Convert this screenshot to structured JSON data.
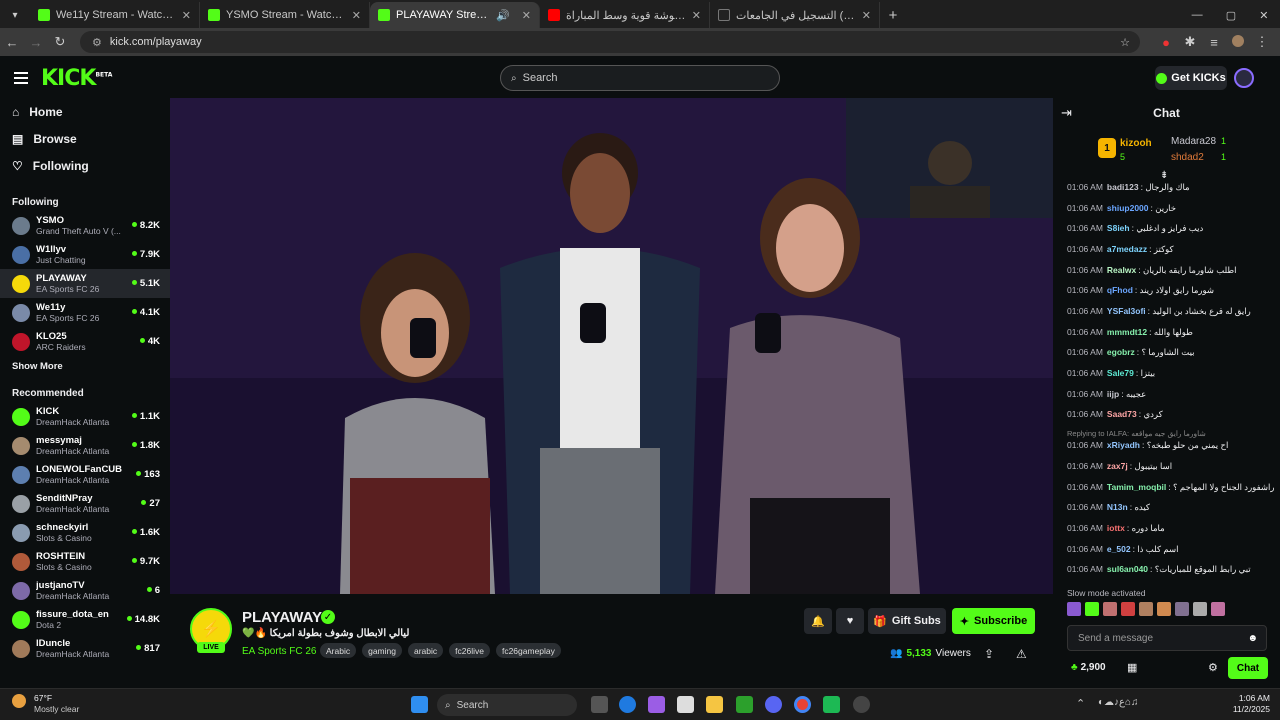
{
  "browser": {
    "tabs": [
      {
        "title": "We11y Stream - Watch Live on"
      },
      {
        "title": "YSMO Stream - Watch Live on"
      },
      {
        "title": "PLAYAWAY Stream - Watch"
      },
      {
        "title": "هوشة قوية وسط المباراة🔥😂"
      },
      {
        "title": "التسجيل في الجامعات (sajjel@)"
      }
    ],
    "url": "kick.com/playaway"
  },
  "header": {
    "logo": "KICK",
    "logo_badge": "BETA",
    "search_placeholder": "Search",
    "get_kicks_label": "Get KICKs"
  },
  "sidebar": {
    "nav": [
      {
        "label": "Home",
        "icon": "home-icon"
      },
      {
        "label": "Browse",
        "icon": "browse-icon"
      },
      {
        "label": "Following",
        "icon": "heart-icon"
      }
    ],
    "following_header": "Following",
    "following": [
      {
        "name": "YSMO",
        "category": "Grand Theft Auto V (...",
        "viewers": "8.2K",
        "color": "#6b7b8c"
      },
      {
        "name": "W1llyv",
        "category": "Just Chatting",
        "viewers": "7.9K",
        "color": "#4a6fa5"
      },
      {
        "name": "PLAYAWAY",
        "category": "EA Sports FC 26",
        "viewers": "5.1K",
        "color": "#f5d90a"
      },
      {
        "name": "We11y",
        "category": "EA Sports FC 26",
        "viewers": "4.1K",
        "color": "#7a8aa8"
      },
      {
        "name": "KLO25",
        "category": "ARC Raiders",
        "viewers": "4K",
        "color": "#c0152a"
      }
    ],
    "show_more_label": "Show More",
    "recommended_header": "Recommended",
    "recommended": [
      {
        "name": "KICK",
        "category": "DreamHack Atlanta",
        "viewers": "1.1K",
        "color": "#53fc18"
      },
      {
        "name": "messymaj",
        "category": "DreamHack Atlanta",
        "viewers": "1.8K",
        "color": "#a58b6f"
      },
      {
        "name": "LONEWOLFanCUB",
        "category": "DreamHack Atlanta",
        "viewers": "163",
        "color": "#5d7fb0"
      },
      {
        "name": "SenditNPray",
        "category": "DreamHack Atlanta",
        "viewers": "27",
        "color": "#9aa0a6"
      },
      {
        "name": "schneckyirl",
        "category": "Slots & Casino",
        "viewers": "1.6K",
        "color": "#8a9bb0"
      },
      {
        "name": "ROSHTEIN",
        "category": "Slots & Casino",
        "viewers": "9.7K",
        "color": "#b05a3a"
      },
      {
        "name": "justjanoTV",
        "category": "DreamHack Atlanta",
        "viewers": "6",
        "color": "#7d6aa8"
      },
      {
        "name": "fissure_dota_en",
        "category": "Dota 2",
        "viewers": "14.8K",
        "color": "#53fc18"
      },
      {
        "name": "lDuncle",
        "category": "DreamHack Atlanta",
        "viewers": "817",
        "color": "#a07a5a"
      }
    ]
  },
  "stream": {
    "channel": "PLAYAWAY",
    "title": "ليالي الابطال وشوف بطولة امريكا 🔥💚",
    "category": "EA Sports FC 26",
    "tags": [
      "Arabic",
      "gaming",
      "arabic",
      "fc26live",
      "fc26gameplay"
    ],
    "live_label": "LIVE",
    "gift_subs_label": "Gift Subs",
    "subscribe_label": "Subscribe",
    "viewers": "5,133",
    "viewers_label": "Viewers"
  },
  "chat": {
    "title": "Chat",
    "leaderboard": [
      {
        "rank": "1",
        "name": "kizooh",
        "count": "5",
        "color": "#f5b400"
      },
      {
        "name": "Madara28",
        "count": "1",
        "color": "#c8c8d0"
      },
      {
        "name": "shdad2",
        "count": "1",
        "color": "#e07a3a"
      }
    ],
    "messages": [
      {
        "time": "01:06 AM",
        "user": "badi123",
        "text": "ماك والرجال",
        "color": "#c8c8d0"
      },
      {
        "time": "01:06 AM",
        "user": "shiup2000",
        "text": "خارين",
        "color": "#6ba6ff"
      },
      {
        "time": "01:06 AM",
        "user": "S8ieh",
        "text": "ديب فرايز و ادغلبي",
        "color": "#7dd3fc"
      },
      {
        "time": "01:06 AM",
        "user": "a7medazz",
        "text": "كوكتز",
        "color": "#7dd3fc"
      },
      {
        "time": "01:06 AM",
        "user": "Realwx",
        "text": "اطلب شاورما رايقه بالريان",
        "color": "#b9f5c4"
      },
      {
        "time": "01:06 AM",
        "user": "qFhod",
        "text": "شورما رايق اولاد ريند",
        "color": "#6ba6ff"
      },
      {
        "time": "01:06 AM",
        "user": "YSFal3ofi",
        "text": "رايق له فرع بخشاد بن الوليد",
        "color": "#93c5fd"
      },
      {
        "time": "01:06 AM",
        "user": "mmmdt12",
        "text": "طولها والله",
        "color": "#86efac"
      },
      {
        "time": "01:06 AM",
        "user": "egobrz",
        "text": "بيت الشاورما ؟",
        "color": "#86efac"
      },
      {
        "time": "01:06 AM",
        "user": "Sale79",
        "text": "بيتزا",
        "color": "#5eead4"
      },
      {
        "time": "01:06 AM",
        "user": "iijp",
        "text": "عجيبه",
        "color": "#c8c8d0"
      },
      {
        "time": "01:06 AM",
        "user": "Saad73",
        "text": "كردي",
        "color": "#fca5a5"
      },
      {
        "time": "01:06 AM",
        "user": "xRiyadh",
        "text": "اح يمني من حلو طبخه؟",
        "color": "#93c5fd"
      },
      {
        "time": "01:06 AM",
        "user": "zax7j",
        "text": "اسا بيتيبول",
        "color": "#fca5a5"
      },
      {
        "time": "01:06 AM",
        "user": "Tamim_moqbil",
        "text": "راشفورد الجناح ولا المهاجم ؟",
        "color": "#86efac"
      },
      {
        "time": "01:06 AM",
        "user": "N13n",
        "text": "كيده",
        "color": "#93c5fd"
      },
      {
        "time": "01:06 AM",
        "user": "iottx",
        "text": "ماما دوره",
        "color": "#f87171"
      },
      {
        "time": "01:06 AM",
        "user": "e_502",
        "text": "اسم كلب ذا",
        "color": "#93c5fd"
      },
      {
        "time": "01:06 AM",
        "user": "sul6an040",
        "text": "تبي رابط الموقع للمباريات؟",
        "color": "#86efac"
      }
    ],
    "reply_label": "Replying to IALFA: شاورما رايق جيه مواقعه",
    "slow_mode": "Slow mode activated",
    "input_placeholder": "Send a message",
    "kicks_count": "2,900",
    "send_label": "Chat"
  },
  "taskbar": {
    "weather_temp": "67°F",
    "weather_desc": "Mostly clear",
    "search_label": "Search",
    "time": "1:06 AM",
    "date": "11/2/2025"
  }
}
